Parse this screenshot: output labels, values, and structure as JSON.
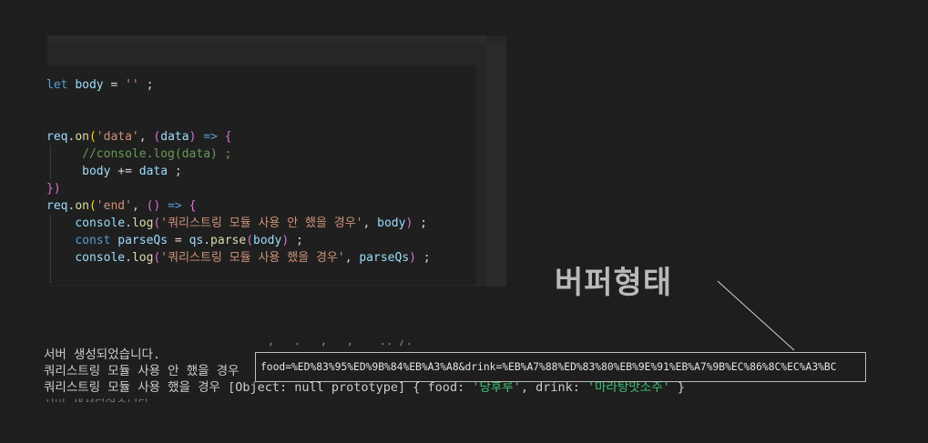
{
  "editor": {
    "lines": [
      {
        "indent": 0,
        "guides": [],
        "tokens": [
          {
            "t": "let",
            "c": "kw"
          },
          {
            "t": " "
          },
          {
            "t": "body",
            "c": "var"
          },
          {
            "t": " = "
          },
          {
            "t": "''",
            "c": "str"
          },
          {
            "t": " ;"
          }
        ]
      },
      {
        "indent": 0,
        "guides": [],
        "tokens": []
      },
      {
        "indent": 0,
        "guides": [],
        "tokens": []
      },
      {
        "indent": 0,
        "guides": [],
        "tokens": [
          {
            "t": "req",
            "c": "var"
          },
          {
            "t": "."
          },
          {
            "t": "on",
            "c": "fn"
          },
          {
            "t": "(",
            "c": "br1"
          },
          {
            "t": "'data'",
            "c": "str"
          },
          {
            "t": ", "
          },
          {
            "t": "(",
            "c": "br2"
          },
          {
            "t": "data",
            "c": "var"
          },
          {
            "t": ")",
            "c": "br2"
          },
          {
            "t": " "
          },
          {
            "t": "=>",
            "c": "kw"
          },
          {
            "t": " "
          },
          {
            "t": "{",
            "c": "br2"
          }
        ]
      },
      {
        "indent": 0,
        "guides": [
          1
        ],
        "tokens": [
          {
            "t": "     "
          },
          {
            "t": "//console.log(data) ;",
            "c": "cm"
          }
        ]
      },
      {
        "indent": 0,
        "guides": [
          1
        ],
        "tokens": [
          {
            "t": "     "
          },
          {
            "t": "body",
            "c": "var"
          },
          {
            "t": " += "
          },
          {
            "t": "data",
            "c": "var"
          },
          {
            "t": " ;"
          }
        ]
      },
      {
        "indent": 0,
        "guides": [],
        "tokens": [
          {
            "t": "})",
            "c": "br2"
          }
        ]
      },
      {
        "indent": 0,
        "guides": [],
        "tokens": [
          {
            "t": "req",
            "c": "var"
          },
          {
            "t": "."
          },
          {
            "t": "on",
            "c": "fn"
          },
          {
            "t": "(",
            "c": "br1"
          },
          {
            "t": "'end'",
            "c": "str"
          },
          {
            "t": ", "
          },
          {
            "t": "()",
            "c": "br2"
          },
          {
            "t": " "
          },
          {
            "t": "=>",
            "c": "kw"
          },
          {
            "t": " "
          },
          {
            "t": "{",
            "c": "br2"
          }
        ]
      },
      {
        "indent": 0,
        "guides": [
          1
        ],
        "tokens": [
          {
            "t": "    "
          },
          {
            "t": "console",
            "c": "var"
          },
          {
            "t": "."
          },
          {
            "t": "log",
            "c": "fn"
          },
          {
            "t": "(",
            "c": "br2"
          },
          {
            "t": "'쿼리스트링 모듈 사용 안 했을 경우'",
            "c": "str"
          },
          {
            "t": ", "
          },
          {
            "t": "body",
            "c": "var"
          },
          {
            "t": ")",
            "c": "br2"
          },
          {
            "t": " ;"
          }
        ]
      },
      {
        "indent": 0,
        "guides": [
          1
        ],
        "tokens": [
          {
            "t": "    "
          },
          {
            "t": "const",
            "c": "kw"
          },
          {
            "t": " "
          },
          {
            "t": "parseQs",
            "c": "var"
          },
          {
            "t": " = "
          },
          {
            "t": "qs",
            "c": "var"
          },
          {
            "t": "."
          },
          {
            "t": "parse",
            "c": "fn"
          },
          {
            "t": "(",
            "c": "br2"
          },
          {
            "t": "body",
            "c": "var"
          },
          {
            "t": ")",
            "c": "br2"
          },
          {
            "t": " ;"
          }
        ]
      },
      {
        "indent": 0,
        "guides": [
          1
        ],
        "tokens": [
          {
            "t": "    "
          },
          {
            "t": "console",
            "c": "var"
          },
          {
            "t": "."
          },
          {
            "t": "log",
            "c": "fn"
          },
          {
            "t": "(",
            "c": "br2"
          },
          {
            "t": "'쿼리스트링 모듈 사용 했을 경우'",
            "c": "str"
          },
          {
            "t": ", "
          },
          {
            "t": "parseQs",
            "c": "var"
          },
          {
            "t": ")",
            "c": "br2"
          },
          {
            "t": " ;"
          }
        ]
      },
      {
        "indent": 0,
        "guides": [
          1
        ],
        "tokens": []
      }
    ]
  },
  "annotation": {
    "label": "버퍼형태"
  },
  "terminal": {
    "line1": "서버 생성되었습니다.",
    "line2_prefix": "쿼리스트링 모듈 사용 안 했을 경우",
    "line3_prefix": "쿼리스트링 모듈 사용 했을 경우 ",
    "line3_obj": "[Object: null prototype] { food: ",
    "line3_food": "'당후루'",
    "line3_mid": ", drink: ",
    "line3_drink": "'마라탕맛소주'",
    "line3_end": " }"
  },
  "buffer_box": {
    "text": "food=%ED%83%95%ED%9B%84%EB%A3%A8&drink=%EB%A7%88%ED%83%80%EB%9E%91%EB%A7%9B%EC%86%8C%EC%A3%BC"
  },
  "colors": {
    "background": "#1e1e1e",
    "keyword": "#569cd6",
    "variable": "#9cdcfe",
    "function": "#dcdcaa",
    "string": "#ce9178",
    "comment": "#6a9955",
    "terminal_string": "#3ec476"
  }
}
